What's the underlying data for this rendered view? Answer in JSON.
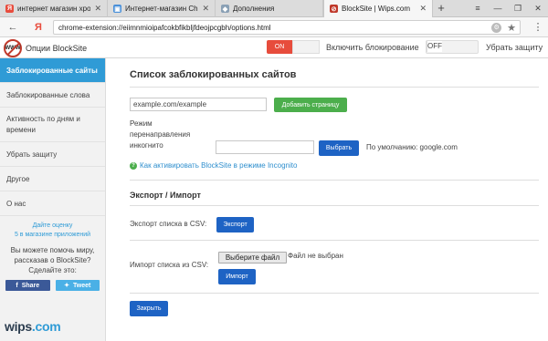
{
  "browser": {
    "tabs": [
      {
        "title": "интернет магазин хром —",
        "favicon": "yandex-icon",
        "color": "#e84c3d",
        "glyph": "Я"
      },
      {
        "title": "Интернет-магазин Chrome",
        "favicon": "chrome-store-icon",
        "color": "#4a90d9",
        "glyph": "▣"
      },
      {
        "title": "Дополнения",
        "favicon": "extensions-icon",
        "color": "#8aa0b5",
        "glyph": "◆"
      },
      {
        "title": "BlockSite | Wips.com",
        "favicon": "blocksite-icon",
        "color": "#c0392b",
        "glyph": "⊘"
      }
    ],
    "new_tab_label": "+",
    "window": {
      "menu": "≡",
      "minimize": "—",
      "restore": "❐",
      "close": "✕"
    },
    "address": {
      "back": "←",
      "yandex": "Я",
      "url": "chrome-extension://eiimnmioipafcokbfikbljfdeojpcgbh/options.html",
      "star": "★",
      "menu": "⋮"
    }
  },
  "header": {
    "title": "Опции BlockSite",
    "logo_text": "WWW",
    "block_toggle": {
      "on_label": "ON",
      "label": "Включить блокирование"
    },
    "protect_toggle": {
      "off_label": "OFF",
      "label": "Убрать защиту"
    }
  },
  "sidebar": {
    "items": [
      {
        "label": "Заблокированные сайты",
        "active": true
      },
      {
        "label": "Заблокированные слова",
        "active": false
      },
      {
        "label": "Активность по дням и времени",
        "active": false
      },
      {
        "label": "Убрать защиту",
        "active": false
      },
      {
        "label": "Другое",
        "active": false
      },
      {
        "label": "О нас",
        "active": false
      }
    ],
    "rate_line1": "Дайте оценку",
    "rate_line2": "5 в магазине приложений",
    "help_line1": "Вы можете помочь миру,",
    "help_line2": "рассказав о BlockSite?",
    "help_line3": "Сделайте это:",
    "share": {
      "facebook": "Share",
      "twitter": "Tweet"
    }
  },
  "main": {
    "title": "Список заблокированных сайтов",
    "site_input_value": "example.com/example",
    "add_page_button": "Добавить страницу",
    "redirect_label_1": "Режим",
    "redirect_label_2": "перенаправления",
    "redirect_label_3": "инкогнито",
    "redirect_input_value": "",
    "choose_button": "Выбрать",
    "default_text": "По умолчанию: google.com",
    "incognito_link": "Как активировать BlockSite в режиме Incognito",
    "export_import_title": "Экспорт / Импорт",
    "export_label": "Экспорт списка в CSV:",
    "export_button": "Экспорт",
    "import_label": "Импорт списка из CSV:",
    "file_button": "Выберите файл",
    "file_status": "Файл не выбран",
    "import_button": "Импорт",
    "close_button": "Закрыть"
  },
  "watermark": {
    "part1": "wips",
    "part2": ".com"
  }
}
